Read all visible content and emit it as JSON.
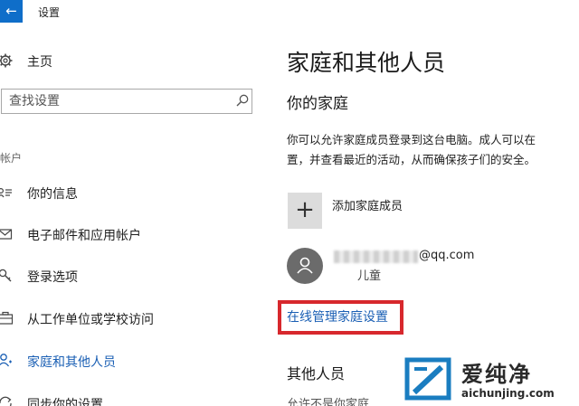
{
  "window": {
    "back_glyph": "←",
    "title": "设置"
  },
  "sidebar": {
    "home_label": "主页",
    "search_placeholder": "查找设置",
    "section_label": "帐户",
    "items": [
      {
        "label": "你的信息",
        "icon": "person-card-icon",
        "active": false
      },
      {
        "label": "电子邮件和应用帐户",
        "icon": "mail-icon",
        "active": false
      },
      {
        "label": "登录选项",
        "icon": "key-icon",
        "active": false
      },
      {
        "label": "从工作单位或学校访问",
        "icon": "briefcase-icon",
        "active": false
      },
      {
        "label": "家庭和其他人员",
        "icon": "person-icon",
        "active": true
      },
      {
        "label": "同步你的设置",
        "icon": "sync-icon",
        "active": false
      }
    ]
  },
  "main": {
    "page_title": "家庭和其他人员",
    "family_title": "你的家庭",
    "desc_line1": "你可以允许家庭成员登录到这台电脑。成人可以在",
    "desc_line2": "置，并查看最近的活动，从而确保孩子们的安全。",
    "add_member_label": "添加家庭成员",
    "plus_glyph": "+",
    "member": {
      "email_suffix": "@qq.com",
      "role": "儿童"
    },
    "manage_link": "在线管理家庭设置",
    "other_title": "其他人员",
    "cutoff_text": "允许不是你家庭"
  },
  "watermark": {
    "title": "爱纯净",
    "url": "aichunjing.com"
  },
  "colors": {
    "accent": "#0f6ec9",
    "link": "#1a5fb4",
    "highlight_box": "#d7282d"
  }
}
